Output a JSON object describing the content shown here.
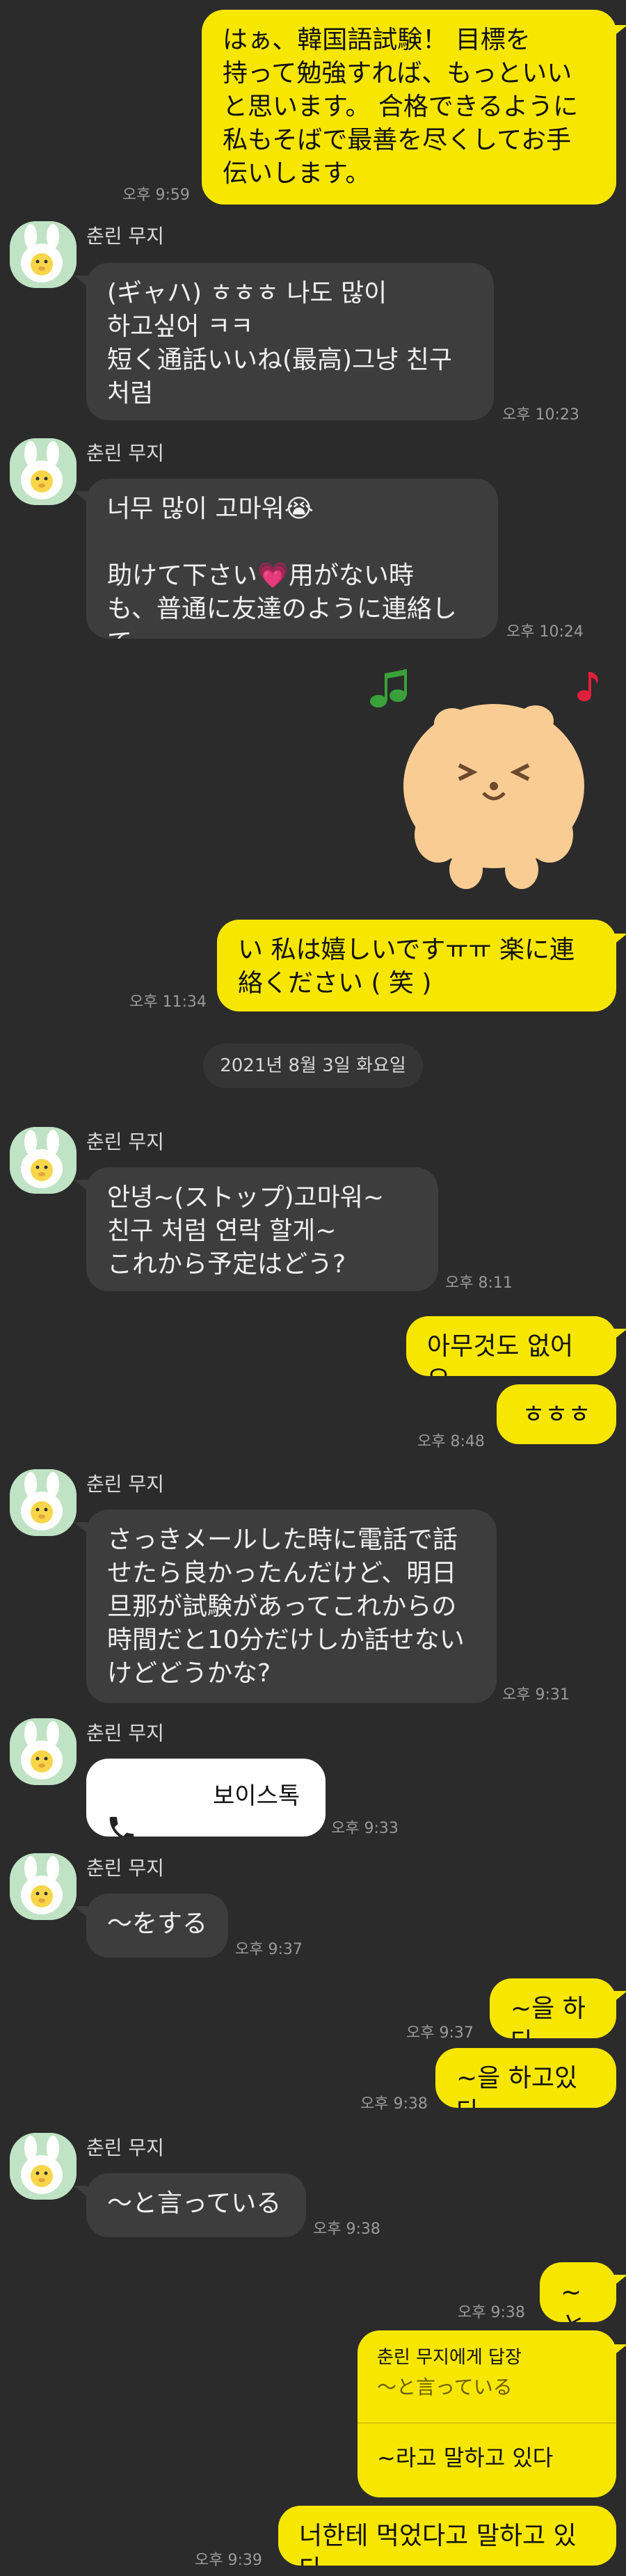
{
  "contact_name": "춘린 무지",
  "date_divider": "2021년 8월 3일 화요일",
  "messages": {
    "m1": {
      "text": "はぁ、韓国語試験！ 目標を\n持って勉強すれば、もっといい\nと思います。 合格できるように\n私もそばで最善を尽くしてお手\n伝いします。",
      "time": "오후 9:59"
    },
    "m2": {
      "text": "(ギャハ) ㅎㅎㅎ 나도 많이\n하고싶어 ㅋㅋ\n短く通話いいね(最高)그냥 친구\n처럼",
      "time": "오후 10:23"
    },
    "m3": {
      "text": "너무 많이 고마워😭\n\n助けて下さい💗用がない時\nも、普通に友達のように連絡し\nて...。",
      "time": "오후 10:24"
    },
    "m4": {
      "text": "い 私は嬉しいですㅠㅠ 楽に連\n絡ください ( 笑 )",
      "time": "오후 11:34"
    },
    "m5": {
      "text": "안녕~(ストップ)고마워~\n친구 처럼 연락 할게~\nこれから予定はどう?",
      "time": "오후 8:11"
    },
    "m6": {
      "text": "아무것도 없어요",
      "time": ""
    },
    "m7": {
      "text": "ㅎㅎㅎ",
      "time": "오후 8:48"
    },
    "m8": {
      "text": "さっきメールした時に電話で話\nせたら良かったんだけど、明日\n旦那が試験があってこれからの\n時間だと10分だけしか話せない\nけどどうかな?",
      "time": "오후 9:31"
    },
    "m9": {
      "text": "보이스톡",
      "time": "오후 9:33"
    },
    "m10": {
      "text": "〜をする",
      "time": "오후 9:37"
    },
    "m11": {
      "text": "~을 하다",
      "time": "오후 9:37"
    },
    "m12": {
      "text": "~을 하고있다",
      "time": "오후 9:38"
    },
    "m13": {
      "text": "〜と言っている",
      "time": "오후 9:38"
    },
    "m14": {
      "text": "~と",
      "time": "오후 9:38"
    },
    "m15": {
      "reply_header": "춘린 무지에게 답장",
      "reply_quote": "〜と言っている",
      "text": "~라고 말하고 있다"
    },
    "m16": {
      "text": "너한테 먹었다고 말하고 있다",
      "time": "오후 9:39"
    }
  },
  "colors": {
    "background": "#2b2b2b",
    "my_bubble": "#f7e600",
    "their_bubble": "#3d3d3d",
    "call_bubble": "#ffffff"
  },
  "icons": {
    "avatar": "muzi-avatar",
    "call": "phone-icon",
    "sticker": "bear-music-sticker"
  }
}
